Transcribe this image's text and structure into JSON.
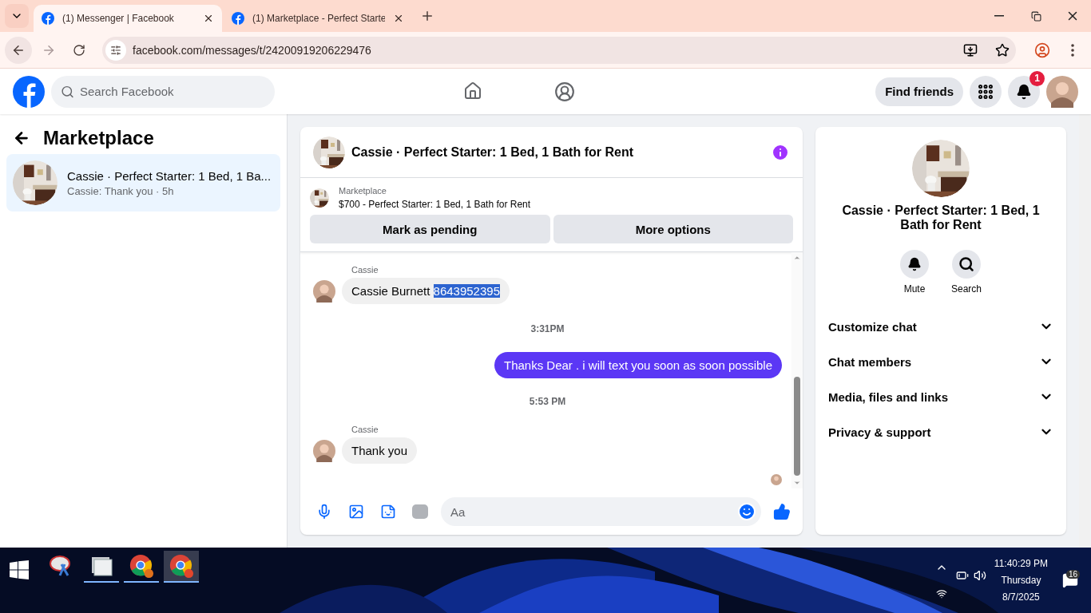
{
  "browser": {
    "tabs": [
      {
        "title": "(1) Messenger | Facebook",
        "selected": true
      },
      {
        "title": "(1) Marketplace - Perfect Starte",
        "selected": false
      }
    ],
    "url": "facebook.com/messages/t/24200919206229476"
  },
  "header": {
    "search_placeholder": "Search Facebook",
    "nav": [
      {
        "kind": "home",
        "selected": false
      },
      {
        "kind": "groups",
        "selected": false
      }
    ],
    "find_friends": "Find friends",
    "notification_count": "1"
  },
  "sidebar": {
    "title": "Marketplace",
    "conversations": [
      {
        "title": "Cassie · Perfect Starter: 1 Bed, 1 Ba...",
        "preview": "Cassie: Thank you · 5h",
        "selected": true
      }
    ]
  },
  "chat": {
    "title": "Cassie · Perfect Starter: 1 Bed, 1 Bath for Rent",
    "listing": {
      "label": "Marketplace",
      "name": "$700 - Perfect Starter: 1 Bed, 1 Bath for Rent"
    },
    "buttons": [
      "Mark as pending",
      "More options"
    ],
    "messages": [
      {
        "kind": "incoming",
        "sender": "Cassie",
        "text": "Cassie Burnett ",
        "selected_text": "8643952395"
      },
      {
        "kind": "time",
        "text": "3:31PM"
      },
      {
        "kind": "outgoing",
        "text": "Thanks Dear . i will text you soon as soon possible"
      },
      {
        "kind": "time",
        "text": "5:53 PM"
      },
      {
        "kind": "incoming",
        "sender": "Cassie",
        "text": "Thank you"
      }
    ],
    "read_receipt": true,
    "composer_placeholder": "Aa"
  },
  "details": {
    "title": "Cassie · Perfect Starter: 1 Bed, 1 Bath for Rent",
    "actions": [
      {
        "kind": "mute",
        "label": "Mute"
      },
      {
        "kind": "search",
        "label": "Search"
      }
    ],
    "sections": [
      {
        "label": "Customize chat",
        "expanded": false
      },
      {
        "label": "Chat members",
        "expanded": false
      },
      {
        "label": "Media, files and links",
        "expanded": false
      },
      {
        "label": "Privacy & support",
        "expanded": false
      }
    ]
  },
  "taskbar": {
    "apps": [
      {
        "kind": "snip",
        "running": false,
        "selected": false
      },
      {
        "kind": "files",
        "running": true,
        "selected": false
      },
      {
        "kind": "chrome",
        "running": true,
        "selected": false
      },
      {
        "kind": "chrome2",
        "running": true,
        "selected": true
      }
    ],
    "time": "11:40:29 PM",
    "day": "Thursday",
    "date": "8/7/2025",
    "notification_count": "16"
  }
}
